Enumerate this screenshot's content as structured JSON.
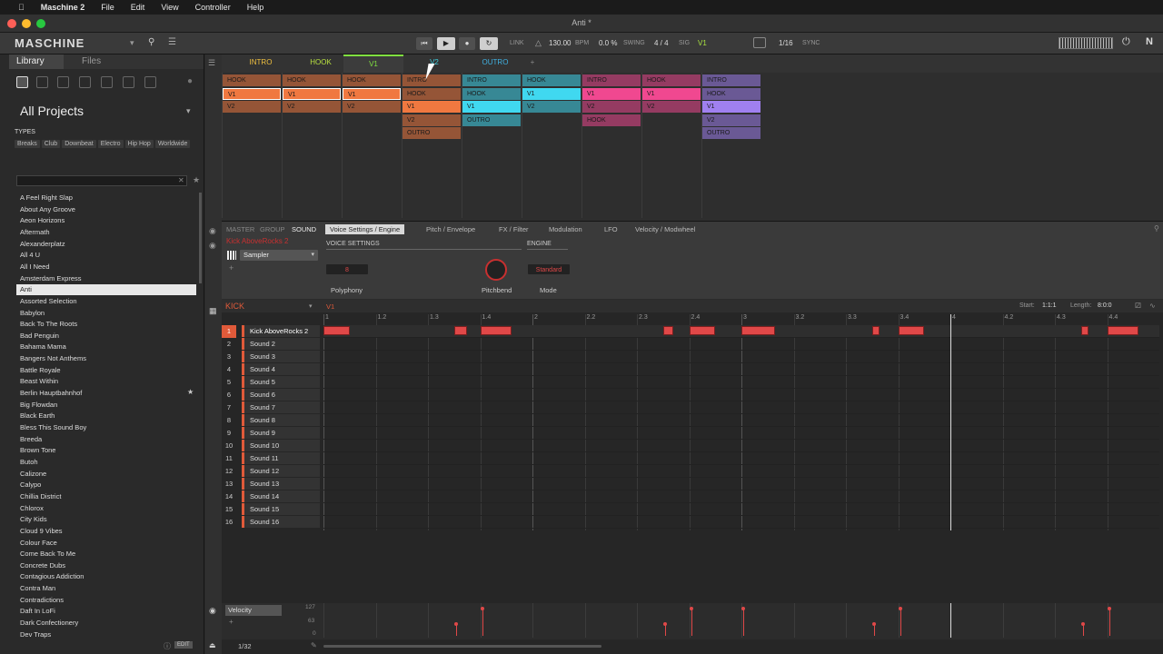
{
  "menubar": {
    "app": "Maschine 2",
    "items": [
      "File",
      "Edit",
      "View",
      "Controller",
      "Help"
    ]
  },
  "window": {
    "title": "Anti *"
  },
  "toolbar": {
    "logo": "MASCHINE",
    "link": "LINK",
    "bpm": "130.00",
    "bpm_unit": "BPM",
    "swing": "0.0 %",
    "swing_label": "SWING",
    "sig": "4 / 4",
    "sig_label": "SIG",
    "scene": "V1",
    "grid": "1/16",
    "sync": "SYNC"
  },
  "library": {
    "tabs": [
      "Library",
      "Files"
    ],
    "heading": "All Projects",
    "types_label": "TYPES",
    "types": [
      "Breaks",
      "Club",
      "Downbeat",
      "Electro",
      "Hip Hop",
      "Worldwide"
    ],
    "projects": [
      "A Feel Right Slap",
      "About Any Groove",
      "Aeon Horizons",
      "Aftermath",
      "Alexanderplatz",
      "All 4 U",
      "All I Need",
      "Amsterdam Express",
      "Anti",
      "Assorted Selection",
      "Babylon",
      "Back To The Roots",
      "Bad Penguin",
      "Bahama Mama",
      "Bangers Not Anthems",
      "Battle Royale",
      "Beast Within",
      "Berlin Hauptbahnhof",
      "Big Flowdan",
      "Black Earth",
      "Bless This Sound Boy",
      "Breeda",
      "Brown Tone",
      "Butoh",
      "Calizone",
      "Calypo",
      "Chillia District",
      "Chlorox",
      "City Kids",
      "Cloud 9 Vibes",
      "Colour Face",
      "Come Back To Me",
      "Concrete Dubs",
      "Contagious Addiction",
      "Contra Man",
      "Contradictions",
      "Daft In LoFi",
      "Dark Confectionery",
      "Dev Traps"
    ],
    "selected": "Anti",
    "edit": "EDIT"
  },
  "scenes": [
    {
      "label": "INTRO",
      "color": "#f0c040"
    },
    {
      "label": "HOOK",
      "color": "#b8e040"
    },
    {
      "label": "V1",
      "color": "#80e040"
    },
    {
      "label": "V2",
      "color": "#40d0e0"
    },
    {
      "label": "OUTRO",
      "color": "#40b0e0"
    },
    {
      "label": "+",
      "color": "#888888"
    }
  ],
  "groups": [
    {
      "id": "A1",
      "name": "KICK",
      "color": "#f07840",
      "cells": [
        "HOOK",
        "V1",
        "V2"
      ]
    },
    {
      "id": "B1",
      "name": "SNARE",
      "color": "#f07840",
      "cells": [
        "HOOK",
        "V1",
        "V2"
      ]
    },
    {
      "id": "C1",
      "name": "HIHAT",
      "color": "#f07840",
      "cells": [
        "HOOK",
        "V1",
        "V2"
      ]
    },
    {
      "id": "D1",
      "name": "PERCS",
      "color": "#f07840",
      "cells": [
        "INTRO",
        "HOOK",
        "V1",
        "V2",
        "OUTRO"
      ]
    },
    {
      "id": "E1",
      "name": "MELODICS 1",
      "color": "#40d8f0",
      "cells": [
        "INTRO",
        "HOOK",
        "V1",
        "OUTRO"
      ]
    },
    {
      "id": "F1",
      "name": "MELODICS 2",
      "color": "#40d8f0",
      "cells": [
        "HOOK",
        "V1",
        "V2"
      ]
    },
    {
      "id": "G1",
      "name": "VOX 1",
      "color": "#f04890",
      "cells": [
        "INTRO",
        "V1",
        "V2",
        "HOOK"
      ]
    },
    {
      "id": "H1",
      "name": "VOX 2",
      "color": "#f04890",
      "cells": [
        "HOOK",
        "V1",
        "V2"
      ]
    },
    {
      "id": "A2",
      "name": "BASS",
      "color": "#a080f0",
      "cells": [
        "INTRO",
        "HOOK",
        "V1",
        "V2",
        "OUTRO"
      ]
    }
  ],
  "sound": {
    "tabs_left": [
      "MASTER",
      "GROUP",
      "SOUND"
    ],
    "name": "Kick AboveRocks 2",
    "plugin": "Sampler",
    "tabs": [
      "Voice Settings / Engine",
      "Pitch / Envelope",
      "FX / Filter",
      "Modulation",
      "LFO",
      "Velocity / Modwheel"
    ],
    "voice_settings": "VOICE SETTINGS",
    "engine": "ENGINE",
    "polyphony_value": "8",
    "polyphony": "Polyphony",
    "pitchbend": "Pitchbend",
    "mode_value": "Standard",
    "mode": "Mode"
  },
  "pattern": {
    "group": "KICK",
    "pattern": "V1",
    "start_label": "Start:",
    "start": "1:1:1",
    "length_label": "Length:",
    "length": "8:0:0",
    "ruler": [
      "1",
      "1.2",
      "1.3",
      "1.4",
      "2",
      "2.2",
      "2.3",
      "2.4",
      "3",
      "3.2",
      "3.3",
      "3.4",
      "4",
      "4.2",
      "4.3",
      "4.4"
    ],
    "sounds": [
      "Kick AboveRocks 2",
      "Sound 2",
      "Sound 3",
      "Sound 4",
      "Sound 5",
      "Sound 6",
      "Sound 7",
      "Sound 8",
      "Sound 9",
      "Sound 10",
      "Sound 11",
      "Sound 12",
      "Sound 13",
      "Sound 14",
      "Sound 15",
      "Sound 16"
    ],
    "notes": [
      [
        0,
        0.5
      ],
      [
        2.5,
        0.25
      ],
      [
        3,
        0.6
      ],
      [
        6.5,
        0.2
      ],
      [
        7,
        0.5
      ],
      [
        8,
        0.65
      ],
      [
        10.5,
        0.15
      ],
      [
        11,
        0.5
      ],
      [
        14.5,
        0.15
      ],
      [
        15,
        0.6
      ]
    ],
    "velocity_label": "Velocity",
    "vel_max": "127",
    "vel_mid": "63",
    "vel_min": "0",
    "velocities": [
      [
        2.5,
        0.4
      ],
      [
        3,
        0.95
      ],
      [
        6.5,
        0.4
      ],
      [
        7,
        0.95
      ],
      [
        8,
        0.95
      ],
      [
        10.5,
        0.4
      ],
      [
        11,
        0.95
      ],
      [
        14.5,
        0.4
      ],
      [
        15,
        0.95
      ]
    ],
    "page": "1/32"
  }
}
